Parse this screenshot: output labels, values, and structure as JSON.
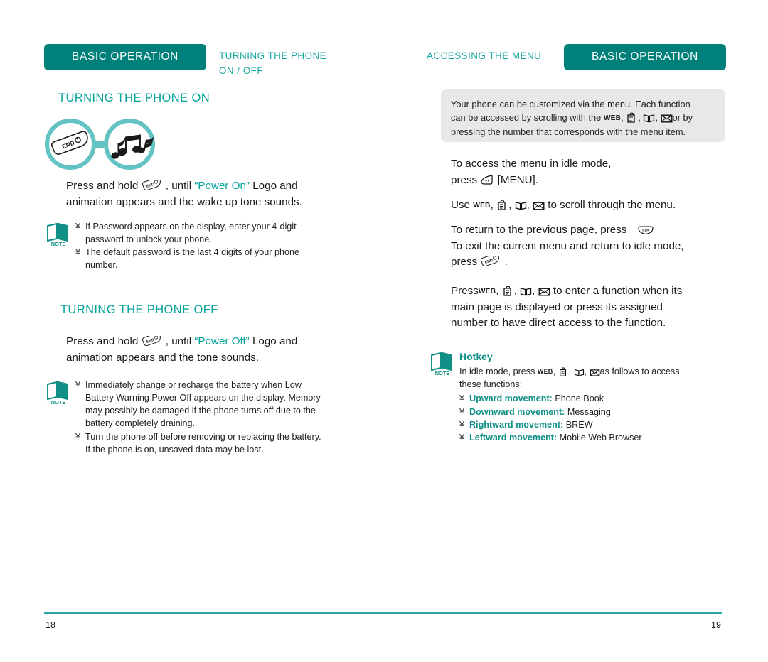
{
  "document": {
    "type": "phone-user-manual-spread",
    "accent_teal": "#00a49b",
    "banner_teal": "#00807a",
    "rule_teal": "#2aa8a8"
  },
  "left_page": {
    "banner": "BASIC OPERATION",
    "running_head_line1": "TURNING THE PHONE",
    "running_head_line2": "ON / OFF",
    "folio": "18",
    "section_on": {
      "heading": "TURNING THE PHONE ON",
      "instruction_pre": "Press and hold",
      "instruction_mid": ", until",
      "instruction_quote": "“Power On”",
      "instruction_post": "Logo and",
      "instruction_line2": "animation appears and the wake up tone sounds.",
      "note": {
        "icon_label": "NOTE",
        "bullets": [
          "If  Password  appears on the display, enter your 4-digit password to unlock your phone.",
          "The default password is the last 4 digits of your phone number."
        ]
      }
    },
    "section_off": {
      "heading": "TURNING THE PHONE OFF",
      "instruction_pre": "Press and hold",
      "instruction_mid": ", until",
      "instruction_quote": "“Power Off”",
      "instruction_post": "Logo and",
      "instruction_line2": "animation appears and the tone sounds.",
      "note": {
        "icon_label": "NOTE",
        "bullets": [
          "Immediately change or recharge the battery when  Low Battery Warning Power Off  appears on the display. Memory may possibly be damaged if the phone turns off due to the battery completely draining.",
          "Turn the phone off before removing or replacing the battery. If the phone is on, unsaved data may be lost."
        ]
      }
    },
    "diagram": {
      "circle1_icon": "end-key-icon",
      "circle1_label": "END",
      "circle2_icon": "music-notes-icon"
    }
  },
  "right_page": {
    "banner": "BASIC OPERATION",
    "running_head": "ACCESSING THE MENU",
    "folio": "19",
    "callout": {
      "line1": "Your phone can be customized via the menu. Each function",
      "line2_a": "can be accessed by scrolling with the",
      "line2_b": "or by",
      "line3": "pressing the number that corresponds with the menu item."
    },
    "paragraphs": {
      "p1_line1": "To access the menu in idle mode,",
      "p1_line2_a": "press",
      "p1_line2_b": "[MENU].",
      "p2_a": "Use",
      "p2_b": "to scroll through the menu.",
      "p3_line1": "To return to the previous page, press",
      "p3_line2": "To exit the current menu and return to idle mode,",
      "p3_line3": "press",
      "p4_a": "Press",
      "p4_b": "to enter a function when its",
      "p4_line2": "main page is displayed or press its assigned",
      "p4_line3": "number to have direct access to the function."
    },
    "hotkey_note": {
      "icon_label": "NOTE",
      "title": "Hotkey",
      "intro_a": "In idle mode, press",
      "intro_b": "as follows to access",
      "intro_line2": "these functions:",
      "items": [
        {
          "label": "Upward movement:",
          "value": "Phone Book"
        },
        {
          "label": "Downward movement:",
          "value": "Messaging"
        },
        {
          "label": "Rightward movement:",
          "value": "BREW"
        },
        {
          "label": "Leftward movement:",
          "value": "Mobile Web Browser"
        }
      ]
    },
    "nav_icons": [
      "WEB",
      "memo-icon",
      "book-icon",
      "envelope-icon"
    ]
  }
}
